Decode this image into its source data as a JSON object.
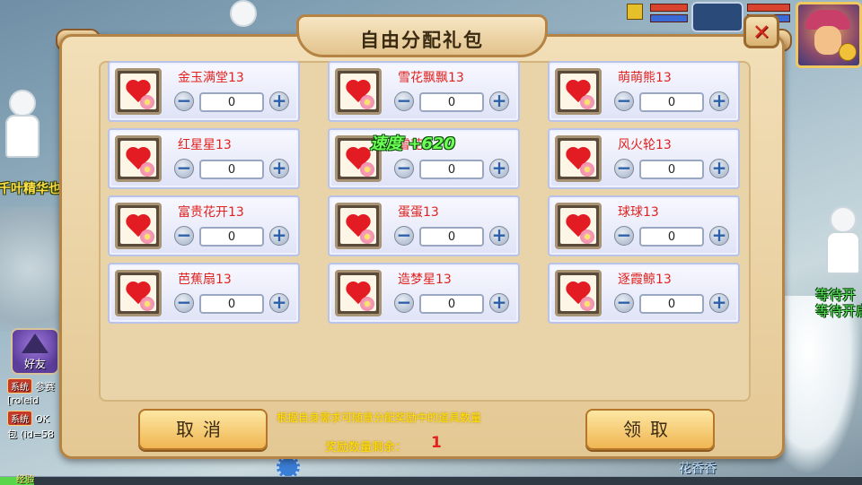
{
  "dialog": {
    "title": "自由分配礼包",
    "close_label": "✕",
    "items": [
      {
        "name": "金玉满堂13",
        "qty": "0"
      },
      {
        "name": "雪花飘飘13",
        "qty": "0"
      },
      {
        "name": "萌萌熊13",
        "qty": "0"
      },
      {
        "name": "红星星13",
        "qty": "0"
      },
      {
        "name": "雪花",
        "qty": "0"
      },
      {
        "name": "风火轮13",
        "qty": "0"
      },
      {
        "name": "富贵花开13",
        "qty": "0"
      },
      {
        "name": "蛋蛋13",
        "qty": "0"
      },
      {
        "name": "球球13",
        "qty": "0"
      },
      {
        "name": "芭蕉扇13",
        "qty": "0"
      },
      {
        "name": "造梦星13",
        "qty": "0"
      },
      {
        "name": "逐霞鲸13",
        "qty": "0"
      }
    ],
    "minus_label": "−",
    "plus_label": "+",
    "cancel_label": "取消",
    "confirm_label": "领取",
    "hint": "根据自身需求可随意分配奖励中的道具数量",
    "remaining_label": "奖励数量剩余：",
    "remaining_value": "1",
    "float_text": "速度 +620"
  },
  "scene": {
    "overhead_left": "千叶精华也",
    "waiting_1": "等待开",
    "waiting_2": "等待开启",
    "friend_label": "好友",
    "chat": [
      {
        "badge": "系统",
        "text": "参赛"
      },
      {
        "badge": "",
        "text": "[roleid"
      },
      {
        "badge": "系统",
        "text": "OK"
      },
      {
        "badge": "",
        "text": "包 (id=58"
      }
    ],
    "exp_label": "经验",
    "bottom_name": "花香香"
  },
  "colors": {
    "accent_red": "#e0231f",
    "hint_yellow": "#ffe400",
    "frame": "#b58445"
  }
}
